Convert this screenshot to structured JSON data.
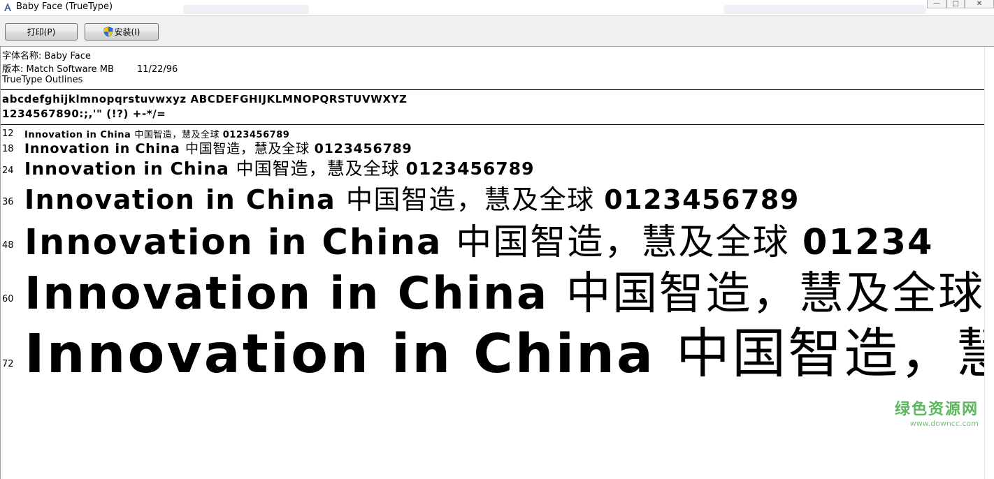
{
  "window": {
    "title": "Baby Face (TrueType)",
    "controls": {
      "minimize": "—",
      "maximize": "□",
      "close": "✕"
    }
  },
  "toolbar": {
    "print_label": "打印(P)",
    "install_label": "安装(I)"
  },
  "font_info": {
    "name_line": "字体名称: Baby Face",
    "version_line": "版本: Match Software MB        11/22/96",
    "outline_line": "TrueType Outlines"
  },
  "charset": {
    "line1": "abcdefghijklmnopqrstuvwxyz ABCDEFGHIJKLMNOPQRSTUVWXYZ",
    "line2": "1234567890:;,'\" (!?) +-*/="
  },
  "samples": [
    {
      "size": "12",
      "latin": "Innovation in China ",
      "cjk": "中国智造，慧及全球 ",
      "digits": "0123456789"
    },
    {
      "size": "18",
      "latin": "Innovation in China ",
      "cjk": "中国智造，慧及全球 ",
      "digits": "0123456789"
    },
    {
      "size": "24",
      "latin": "Innovation in China ",
      "cjk": "中国智造，慧及全球 ",
      "digits": "0123456789"
    },
    {
      "size": "36",
      "latin": "Innovation in China ",
      "cjk": "中国智造，慧及全球 ",
      "digits": "0123456789"
    },
    {
      "size": "48",
      "latin": "Innovation in China ",
      "cjk": "中国智造，慧及全球 ",
      "digits": "01234"
    },
    {
      "size": "60",
      "latin": "Innovation in China ",
      "cjk": "中国智造，慧及全球",
      "digits": ""
    },
    {
      "size": "72",
      "latin": "Innovation in China ",
      "cjk": "中国智造，慧",
      "digits": ""
    }
  ],
  "watermark": {
    "text": "绿色资源网",
    "url": "www.downcc.com"
  },
  "colors": {
    "toolbar_bg": "#f0f0f0",
    "watermark_green": "#5cb85c"
  }
}
